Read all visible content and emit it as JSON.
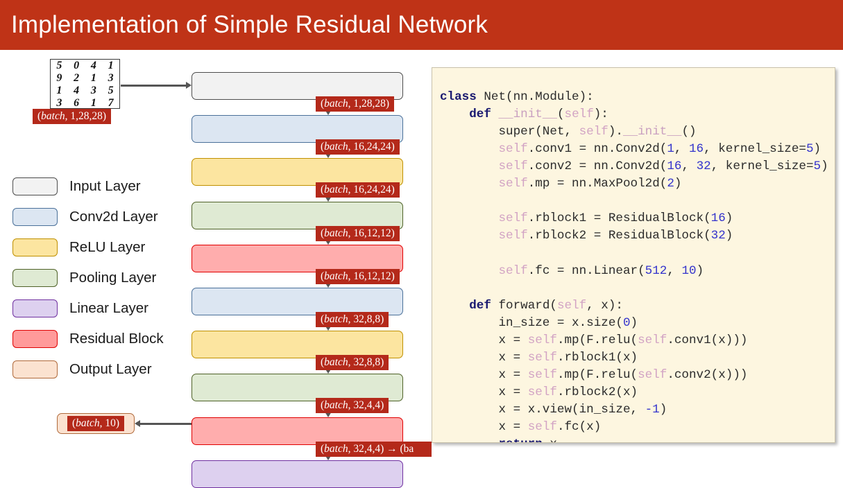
{
  "slide": {
    "title": "Implementation of Simple Residual Network",
    "title_bar_color": "#bf3317"
  },
  "input_thumbnail": {
    "name": "mnist-digit-grid",
    "digits": [
      "5",
      "0",
      "4",
      "1",
      "9",
      "2",
      "1",
      "3",
      "1",
      "4",
      "3",
      "5",
      "3",
      "6",
      "1",
      "7"
    ]
  },
  "input_shape_tag": "(batch, 1,28,28)",
  "diagram": {
    "blocks": [
      {
        "label": "Input Layer",
        "type": "input",
        "fill": "#f2f2f2",
        "stroke": "#4d4d4d"
      },
      {
        "label": "Conv2d Layer",
        "type": "conv",
        "fill": "#dce6f2",
        "stroke": "#4a7099"
      },
      {
        "label": "ReLU Layer",
        "type": "relu",
        "fill": "#fce5a0",
        "stroke": "#bf9000"
      },
      {
        "label": "Pooling Layer",
        "type": "pool",
        "fill": "#dfead3",
        "stroke": "#4f6228"
      },
      {
        "label": "Residual Block",
        "type": "residual",
        "fill": "#ffadad",
        "stroke": "#e00000"
      },
      {
        "label": "Conv2d Layer",
        "type": "conv",
        "fill": "#dce6f2",
        "stroke": "#4a7099"
      },
      {
        "label": "ReLU Layer",
        "type": "relu",
        "fill": "#fce5a0",
        "stroke": "#bf9000"
      },
      {
        "label": "Pooling Layer",
        "type": "pool",
        "fill": "#dfead3",
        "stroke": "#4f6228"
      },
      {
        "label": "Residual Block",
        "type": "residual",
        "fill": "#ffadad",
        "stroke": "#e00000"
      },
      {
        "label": "Linear Layer",
        "type": "linear",
        "fill": "#ddd0ef",
        "stroke": "#7030a0"
      }
    ],
    "shape_tags": [
      "(batch, 1,28,28)",
      "(batch, 16,24,24)",
      "(batch, 16,24,24)",
      "(batch, 16,12,12)",
      "(batch, 16,12,12)",
      "(batch, 32,8,8)",
      "(batch, 32,8,8)",
      "(batch, 32,4,4)",
      "(batch, 32,4,4) → (ba"
    ],
    "tag_color": "#b4291a"
  },
  "output": {
    "label": "(batch, 10)",
    "fill": "#fbe2d0",
    "stroke": "#b06a3b"
  },
  "legend": {
    "items": [
      {
        "label": "Input Layer",
        "fill": "#f2f2f2",
        "stroke": "#4d4d4d"
      },
      {
        "label": "Conv2d Layer",
        "fill": "#dce6f2",
        "stroke": "#4a7099"
      },
      {
        "label": "ReLU Layer",
        "fill": "#fce5a0",
        "stroke": "#bf9000"
      },
      {
        "label": "Pooling Layer",
        "fill": "#dfead3",
        "stroke": "#4f6228"
      },
      {
        "label": "Linear Layer",
        "fill": "#ddd0ef",
        "stroke": "#7030a0"
      },
      {
        "label": "Residual Block",
        "fill": "#ff9a9a",
        "stroke": "#e00000"
      },
      {
        "label": "Output Layer",
        "fill": "#fbe2d0",
        "stroke": "#b06a3b"
      }
    ]
  },
  "code": {
    "language": "python",
    "lines": [
      "class Net(nn.Module):",
      "    def __init__(self):",
      "        super(Net, self).__init__()",
      "        self.conv1 = nn.Conv2d(1, 16, kernel_size=5)",
      "        self.conv2 = nn.Conv2d(16, 32, kernel_size=5)",
      "        self.mp = nn.MaxPool2d(2)",
      "",
      "        self.rblock1 = ResidualBlock(16)",
      "        self.rblock2 = ResidualBlock(32)",
      "",
      "        self.fc = nn.Linear(512, 10)",
      "",
      "    def forward(self, x):",
      "        in_size = x.size(0)",
      "        x = self.mp(F.relu(self.conv1(x)))",
      "        x = self.rblock1(x)",
      "        x = self.mp(F.relu(self.conv2(x)))",
      "        x = self.rblock2(x)",
      "        x = x.view(in_size, -1)",
      "        x = self.fc(x)",
      "        return x"
    ]
  }
}
